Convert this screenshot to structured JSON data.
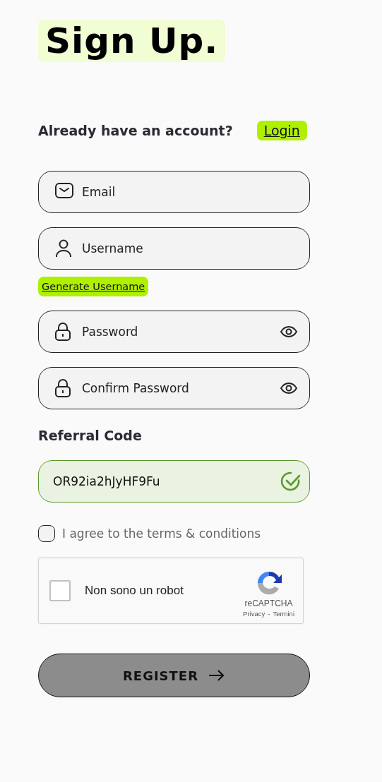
{
  "title": "Sign Up.",
  "login_prompt": {
    "text": "Already have an account?",
    "link": "Login"
  },
  "fields": [
    {
      "kind": "email",
      "placeholder": "Email"
    },
    {
      "kind": "username",
      "placeholder": "Username"
    },
    {
      "kind": "link",
      "label": "Generate Username"
    },
    {
      "kind": "password",
      "placeholder": "Password"
    },
    {
      "kind": "password",
      "placeholder": "Confirm Password"
    }
  ],
  "referral": {
    "label": "Referral Code",
    "value": "OR92ia2hJyHF9Fu",
    "valid": true
  },
  "terms": {
    "label": "I agree to the terms & conditions",
    "checked": false
  },
  "captcha": {
    "label": "Non sono un robot",
    "checked": false,
    "brand": "reCAPTCHA",
    "privacy": "Privacy",
    "separator": "-",
    "terms": "Termini"
  },
  "register": {
    "label": "REGISTER"
  }
}
